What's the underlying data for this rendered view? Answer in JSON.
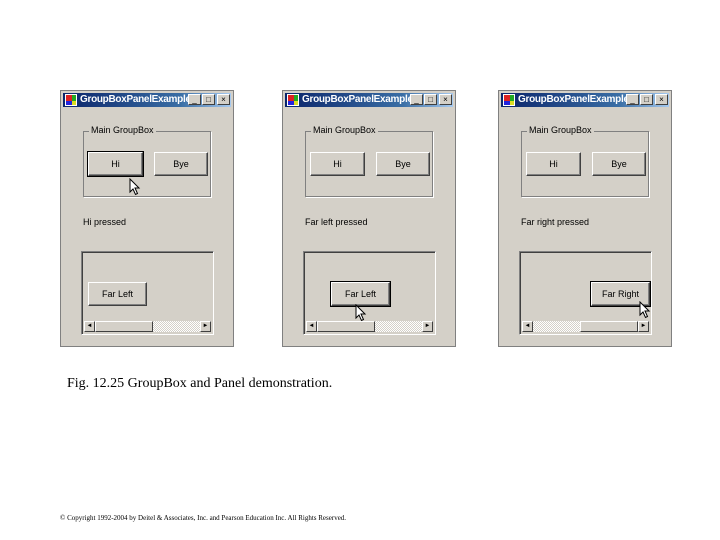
{
  "windows": [
    {
      "title": "GroupBoxPanelExample",
      "group_label": "Main GroupBox",
      "buttons": {
        "hi": "Hi",
        "bye": "Bye"
      },
      "status": "Hi pressed",
      "panel_button": "Far Left",
      "caption_buttons": {
        "minimize": "_",
        "maximize": "□",
        "close": "×"
      },
      "scroll_arrows": {
        "left": "◄",
        "right": "►"
      },
      "scroll_position": 0.0
    },
    {
      "title": "GroupBoxPanelExample",
      "group_label": "Main GroupBox",
      "buttons": {
        "hi": "Hi",
        "bye": "Bye"
      },
      "status": "Far left pressed",
      "panel_button": "Far Left",
      "caption_buttons": {
        "minimize": "_",
        "maximize": "□",
        "close": "×"
      },
      "scroll_arrows": {
        "left": "◄",
        "right": "►"
      },
      "scroll_position": 0.0
    },
    {
      "title": "GroupBoxPanelExample",
      "group_label": "Main GroupBox",
      "buttons": {
        "hi": "Hi",
        "bye": "Bye"
      },
      "status": "Far right pressed",
      "panel_button": "Far Right",
      "caption_buttons": {
        "minimize": "_",
        "maximize": "□",
        "close": "×"
      },
      "scroll_arrows": {
        "left": "◄",
        "right": "►"
      },
      "scroll_position": 1.0
    }
  ],
  "caption": "Fig. 12.25 GroupBox and Panel demonstration.",
  "copyright": "© Copyright 1992-2004 by Deitel & Associates, Inc. and Pearson Education Inc. All Rights Reserved.",
  "colors": {
    "window_face": "#d4d0c8",
    "title_start": "#0a246a",
    "title_end": "#a6caf0"
  }
}
